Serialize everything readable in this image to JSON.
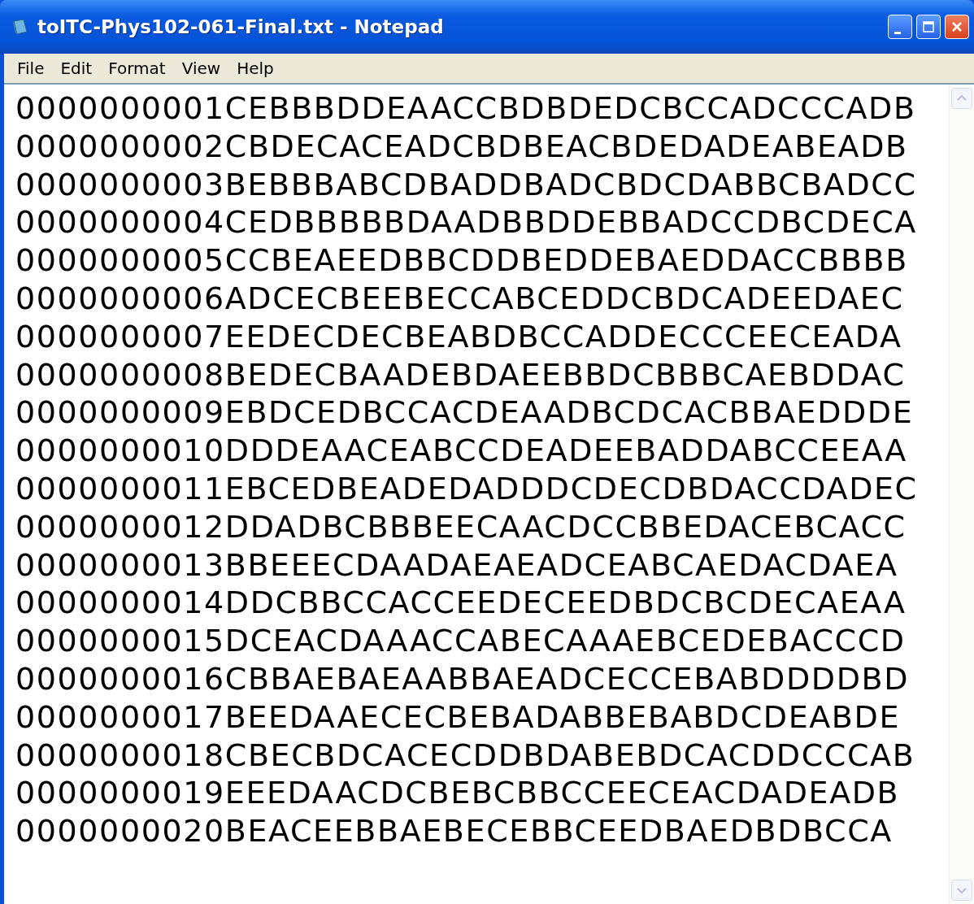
{
  "window": {
    "title": "toITC-Phys102-061-Final.txt - Notepad"
  },
  "menu": [
    {
      "label": "File"
    },
    {
      "label": "Edit"
    },
    {
      "label": "Format"
    },
    {
      "label": "View"
    },
    {
      "label": "Help"
    }
  ],
  "lines": [
    "0000000001CEBBBDDEAACCBDBDEDCBCCADCCCADB",
    "0000000002CBDECACEADCBDBEACBDEDADEABEADB",
    "0000000003BEBBBABCDBADDBADCBDCDABBCBADCC",
    "0000000004CEDBBBBBDAADBBDDEBBADCCDBCDECA",
    "0000000005CCBEAEEDBBCDDBEDDEBAEDDACCBBBB",
    "0000000006ADCECBEEBECCABCEDDCBDCADEEDAEC",
    "0000000007EEDECDECBEABDBCCADDECCCEECEADA",
    "0000000008BEDECBAADEBDAEEBBDCBBBCAEBDDAC",
    "0000000009EBDCEDBCCACDEAADBCDCACBBAEDDDE",
    "0000000010DDDEAACEABCCDEADEEBADDABCCEEAA",
    "0000000011EBCEDBEADEDADDDCDECDBDACCDADEC",
    "0000000012DDADBCBBBEECAACDCCBBEDACEBCACC",
    "0000000013BBEEECDAADAEAEADCEABCAEDACDAEA",
    "0000000014DDCBBCCACCEEDECEEDBDCBCDECAEAA",
    "0000000015DCEACDAAACCABECAAAEBCEDEBACCCD",
    "0000000016CBBAEBAEAABBAEADCECCEBABDDDDBD",
    "0000000017BEEDAAECECBEBADABBEBABDCDEABDE",
    "0000000018CBECBDCACECDDBDABEBDCACDDCCCAB",
    "0000000019EEEDAACDCBEBCBBCCEECEACDADEADB",
    "0000000020BEACEEBBAEBECEBBCEEDBAEDBDBCCA"
  ]
}
